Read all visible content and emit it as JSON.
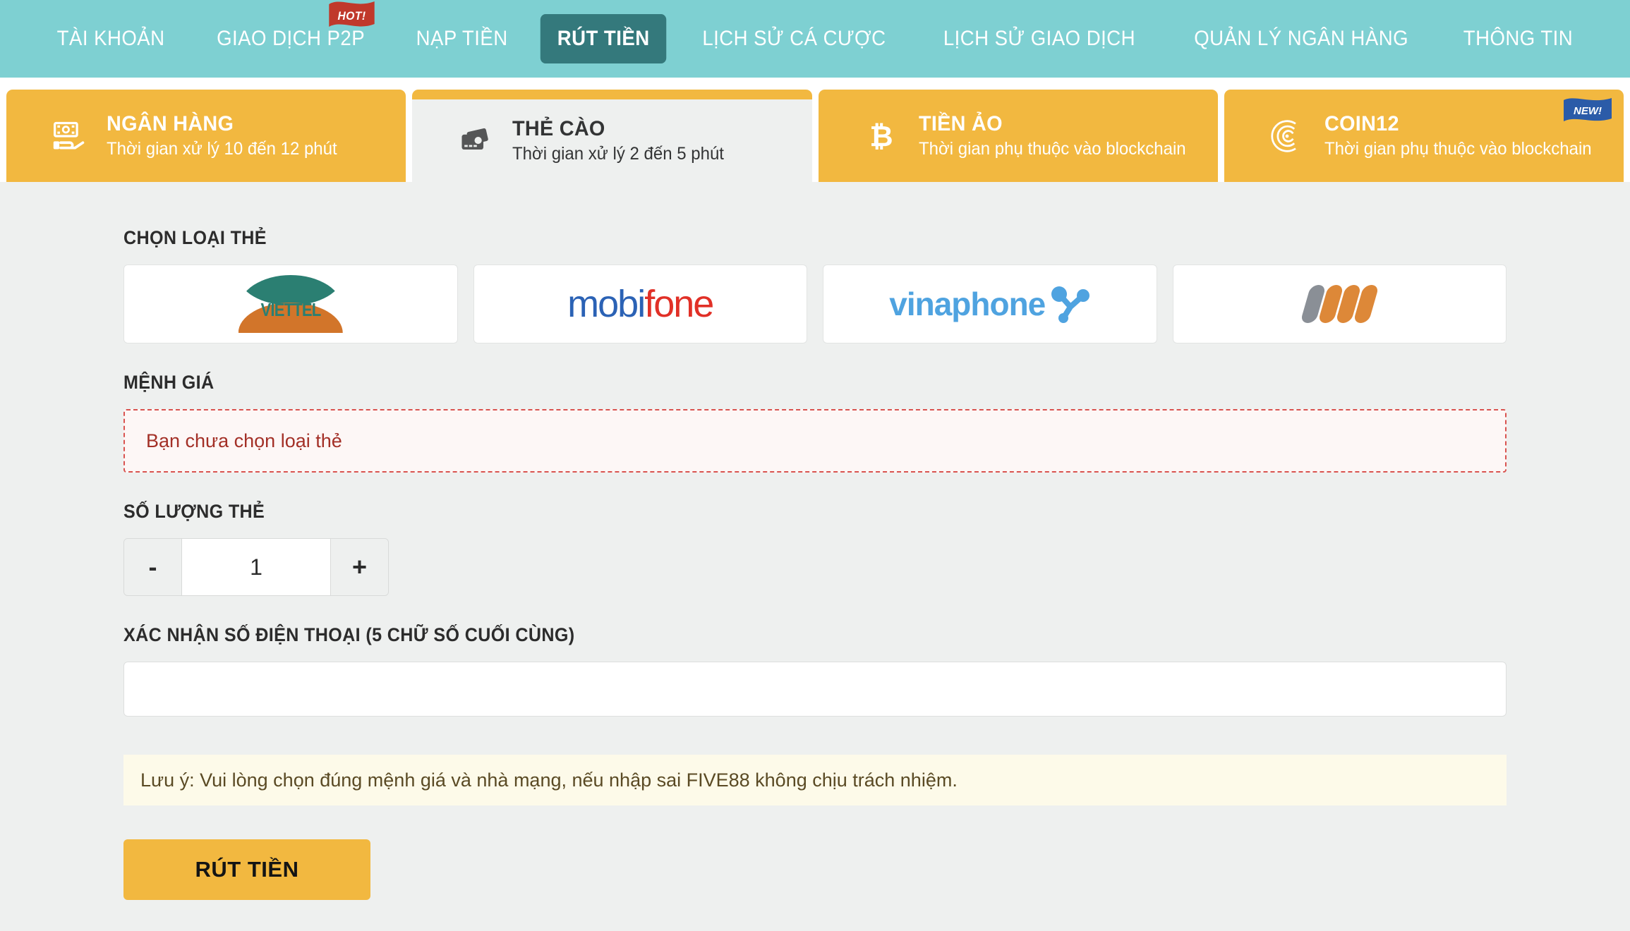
{
  "nav": {
    "items": [
      {
        "label": "TÀI KHOẢN",
        "active": false,
        "badge": ""
      },
      {
        "label": "GIAO DỊCH P2P",
        "active": false,
        "badge": "HOT!"
      },
      {
        "label": "NẠP TIỀN",
        "active": false,
        "badge": ""
      },
      {
        "label": "RÚT TIỀN",
        "active": true,
        "badge": ""
      },
      {
        "label": "LỊCH SỬ CÁ CƯỢC",
        "active": false,
        "badge": ""
      },
      {
        "label": "LỊCH SỬ GIAO DỊCH",
        "active": false,
        "badge": ""
      },
      {
        "label": "QUẢN LÝ NGÂN HÀNG",
        "active": false,
        "badge": ""
      },
      {
        "label": "THÔNG TIN",
        "active": false,
        "badge": ""
      }
    ],
    "bg_color": "#7ed0d2",
    "active_bg_color": "#34797c",
    "hot_badge_color": "#c0392b"
  },
  "methods": [
    {
      "title": "NGÂN HÀNG",
      "subtitle": "Thời gian xử lý 10 đến 12 phút",
      "icon": "money-hand-icon",
      "active": false,
      "badge": ""
    },
    {
      "title": "THẺ CÀO",
      "subtitle": "Thời gian xử lý 2 đến 5 phút",
      "icon": "scratch-card-icon",
      "active": true,
      "badge": ""
    },
    {
      "title": "TIỀN ẢO",
      "subtitle": "Thời gian phụ thuộc vào blockchain",
      "icon": "bitcoin-icon",
      "active": false,
      "badge": ""
    },
    {
      "title": "COIN12",
      "subtitle": "Thời gian phụ thuộc vào blockchain",
      "icon": "coin12-icon",
      "active": false,
      "badge": "NEW!"
    }
  ],
  "method_colors": {
    "tab_bg": "#f2b840",
    "active_tab_bg": "#eef0ef",
    "new_badge_color": "#2b5ba8"
  },
  "form": {
    "card_type_label": "CHỌN LOẠI THẺ",
    "carriers": [
      {
        "name": "viettel",
        "wordmark": "VIETTEL"
      },
      {
        "name": "mobifone",
        "part1": "mobi",
        "part2": "fone"
      },
      {
        "name": "vinaphone",
        "wordmark": "vinaphone"
      },
      {
        "name": "vietnamobile",
        "wordmark": ""
      }
    ],
    "denomination_label": "MỆNH GIÁ",
    "denomination_message": "Bạn chưa chọn loại thẻ",
    "quantity_label": "SỐ LƯỢNG THẺ",
    "quantity_minus": "-",
    "quantity_value": "1",
    "quantity_plus": "+",
    "phone_label": "XÁC NHẬN SỐ ĐIỆN THOẠI (5 CHỮ SỐ CUỐI CÙNG)",
    "phone_value": "",
    "phone_placeholder": "",
    "note": "Lưu ý: Vui lòng chọn đúng mệnh giá và nhà mạng, nếu nhập sai FIVE88 không chịu trách nhiệm.",
    "submit_label": "RÚT TIỀN"
  },
  "colors": {
    "page_bg": "#eef0ef",
    "accent": "#f2b840",
    "error_border": "#d9534f",
    "error_text": "#a33027",
    "note_bg": "#fdfae9",
    "note_text": "#5a4a24"
  }
}
